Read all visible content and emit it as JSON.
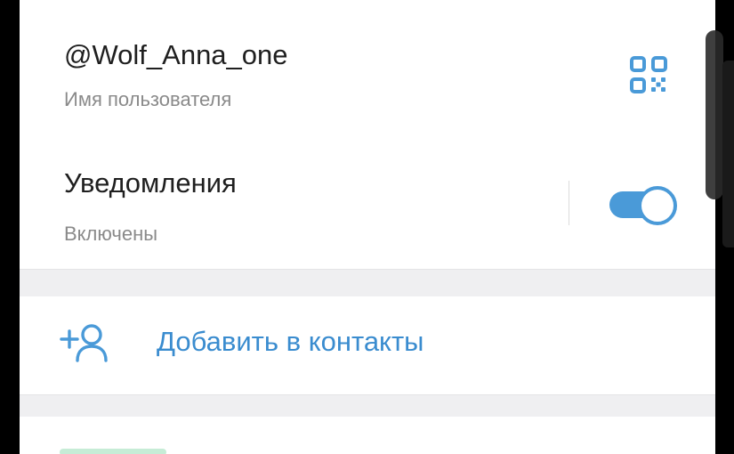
{
  "colors": {
    "accent": "#4a9ad8",
    "link": "#3a8ccf",
    "background": "#ffffff",
    "section_gap": "#efeff1"
  },
  "profile": {
    "username": "@Wolf_Anna_one",
    "username_caption": "Имя пользователя",
    "qr_icon": "qr-code-icon"
  },
  "notifications": {
    "title": "Уведомления",
    "status": "Включены",
    "enabled": true
  },
  "actions": {
    "add_contact_label": "Добавить в контакты",
    "add_contact_icon": "add-user-icon"
  }
}
